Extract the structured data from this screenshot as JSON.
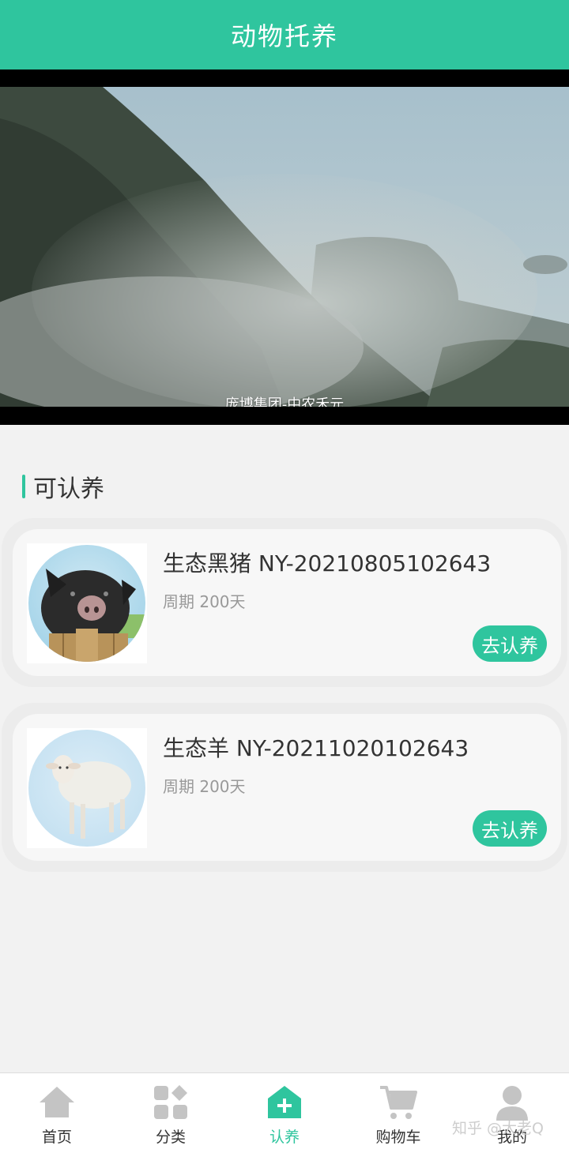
{
  "header": {
    "title": "动物托养"
  },
  "video": {
    "caption": "庞博集团-中农禾元"
  },
  "section": {
    "title": "可认养"
  },
  "items": [
    {
      "name": "生态黑猪 NY-20210805102643",
      "period": "周期 200天",
      "button": "去认养",
      "image_icon": "black-pig-image"
    },
    {
      "name": "生态羊 NY-20211020102643",
      "period": "周期 200天",
      "button": "去认养",
      "image_icon": "sheep-image"
    }
  ],
  "tabbar": {
    "tabs": [
      {
        "label": "首页",
        "icon": "home-icon"
      },
      {
        "label": "分类",
        "icon": "category-icon"
      },
      {
        "label": "认养",
        "icon": "adopt-icon",
        "active": true
      },
      {
        "label": "购物车",
        "icon": "cart-icon"
      },
      {
        "label": "我的",
        "icon": "user-icon"
      }
    ]
  },
  "watermark": "知乎 @大老Q",
  "colors": {
    "accent": "#2fc59e",
    "background": "#f2f2f2",
    "icon_gray": "#c4c4c4"
  }
}
